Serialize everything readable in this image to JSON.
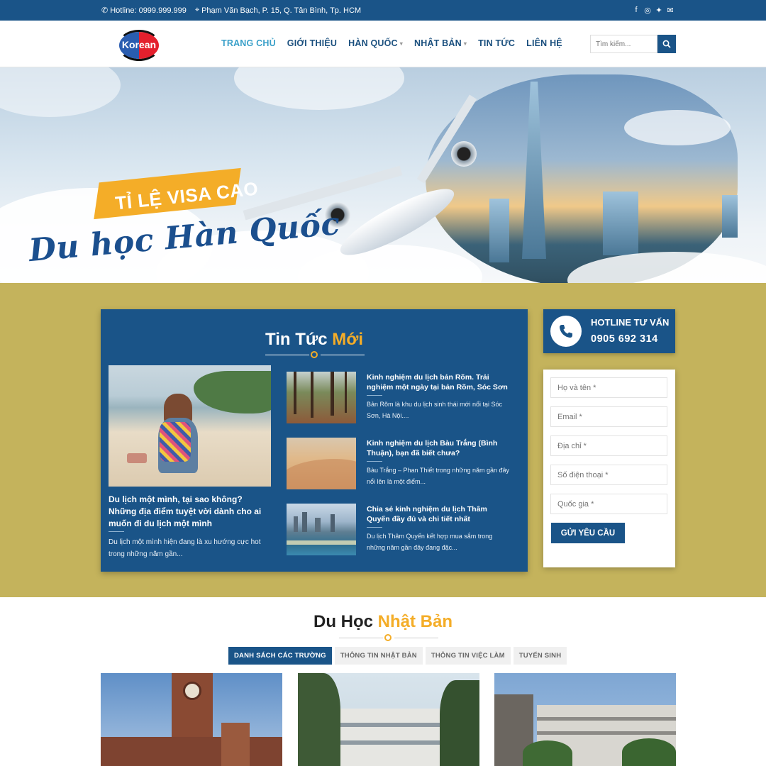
{
  "topbar": {
    "hotline": "Hotline: 0999.999.999",
    "address": "Phạm Văn Bạch, P. 15, Q. Tân Bình, Tp. HCM",
    "social": [
      "facebook-icon",
      "instagram-icon",
      "twitter-icon",
      "email-icon"
    ]
  },
  "logo": {
    "text": "Korean"
  },
  "nav": {
    "items": [
      {
        "label": "TRANG CHỦ",
        "active": true
      },
      {
        "label": "GIỚI THIỆU"
      },
      {
        "label": "HÀN QUỐC",
        "dropdown": true
      },
      {
        "label": "NHẬT BẢN",
        "dropdown": true
      },
      {
        "label": "TIN TỨC"
      },
      {
        "label": "LIÊN HỆ"
      }
    ]
  },
  "search": {
    "placeholder": "Tìm kiếm..."
  },
  "hero": {
    "tag": "TỈ LỆ VISA CAO",
    "title": "Du học Hàn Quốc"
  },
  "news": {
    "title_main": "Tin Tức",
    "title_highlight": "Mới",
    "featured": {
      "title": "Du lịch một mình, tại sao không? Những địa điểm tuyệt vời dành cho ai muốn đi du lịch một mình",
      "desc": "Du lịch một mình hiện đang là xu hướng cực hot trong những năm gần..."
    },
    "items": [
      {
        "title": "Kinh nghiệm du lịch bản Rõm. Trải nghiệm một ngày tại bản Rõm, Sóc Sơn",
        "desc": "Bản Rõm là khu du lịch sinh thái mới nổi tại Sóc Sơn, Hà Nội...."
      },
      {
        "title": "Kinh nghiệm du lịch Bàu Trắng (Bình Thuận), bạn đã biết chưa?",
        "desc": "Bàu Trắng – Phan Thiết trong những năm gần đây nổi lên là một điểm..."
      },
      {
        "title": "Chia sẻ kinh nghiệm du lịch Thâm Quyến đầy đủ và chi tiết nhất",
        "desc": "Du lịch Thâm Quyến kết hợp mua sắm trong những năm gần đây đang đặc..."
      }
    ]
  },
  "hotline": {
    "label": "HOTLINE TƯ VẤN",
    "phone": "0905 692 314"
  },
  "form": {
    "fields": [
      "Họ và tên *",
      "Email *",
      "Địa chỉ *",
      "Số điện thoại *",
      "Quốc gia *"
    ],
    "submit": "GỬI YÊU CẦU"
  },
  "japan": {
    "title_main": "Du Học",
    "title_highlight": "Nhật Bản",
    "tabs": [
      {
        "label": "DANH SÁCH CÁC TRƯỜNG",
        "active": true
      },
      {
        "label": "THÔNG TIN NHẬT BẢN"
      },
      {
        "label": "THÔNG TIN VIỆC LÀM"
      },
      {
        "label": "TUYỂN SINH"
      }
    ]
  },
  "colors": {
    "primary": "#1a5488",
    "accent": "#f4ad28",
    "olive": "#c4b35c",
    "nav_active": "#3aa0c9"
  }
}
